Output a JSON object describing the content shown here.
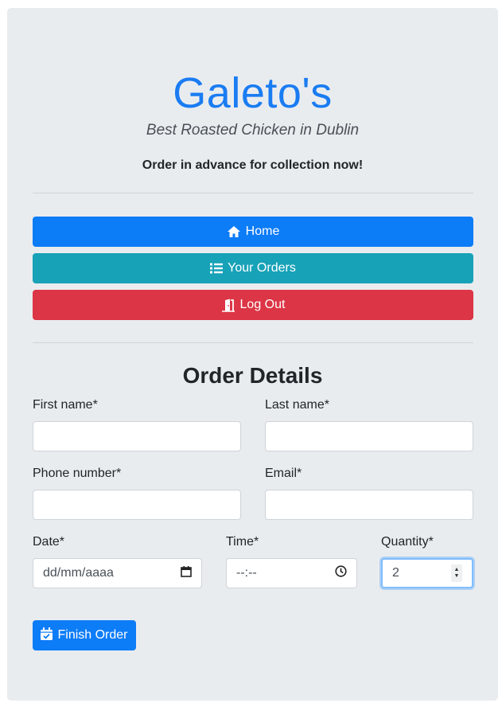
{
  "header": {
    "brand": "Galeto's",
    "tagline": "Best Roasted Chicken in Dublin",
    "promo": "Order in advance for collection now!"
  },
  "nav": {
    "home": {
      "label": "Home",
      "icon": "home-icon"
    },
    "orders": {
      "label": "Your Orders",
      "icon": "list-icon"
    },
    "logout": {
      "label": "Log Out",
      "icon": "door-exit-icon"
    }
  },
  "form": {
    "title": "Order Details",
    "first_name": {
      "label": "First name*",
      "value": ""
    },
    "last_name": {
      "label": "Last name*",
      "value": ""
    },
    "phone": {
      "label": "Phone number*",
      "value": ""
    },
    "email": {
      "label": "Email*",
      "value": ""
    },
    "date": {
      "label": "Date*",
      "placeholder": "dd/mm/aaaa"
    },
    "time": {
      "label": "Time*",
      "placeholder": "--:--"
    },
    "quantity": {
      "label": "Quantity*",
      "value": "2"
    },
    "submit": {
      "label": "Finish Order",
      "icon": "calendar-check-icon"
    }
  },
  "colors": {
    "brand": "#1a7cf2",
    "primary": "#0d7cf7",
    "info": "#17a2b8",
    "danger": "#dc3545",
    "card_bg": "#e9ecef"
  }
}
